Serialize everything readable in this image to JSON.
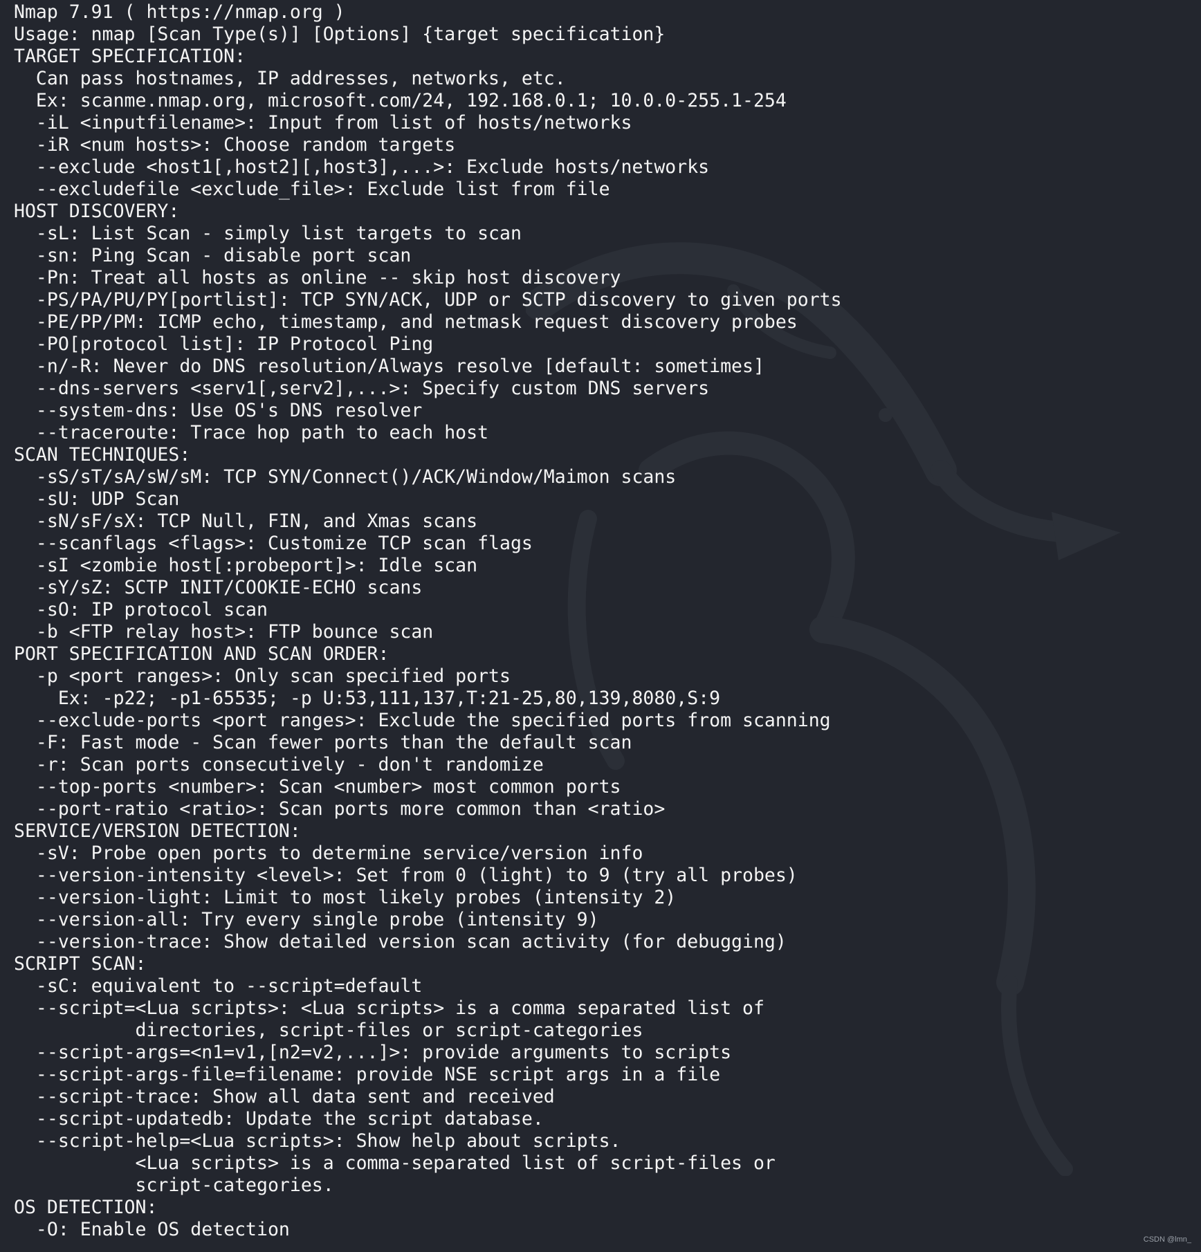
{
  "terminal": {
    "lines": [
      "Nmap 7.91 ( https://nmap.org )",
      "Usage: nmap [Scan Type(s)] [Options] {target specification}",
      "TARGET SPECIFICATION:",
      "  Can pass hostnames, IP addresses, networks, etc.",
      "  Ex: scanme.nmap.org, microsoft.com/24, 192.168.0.1; 10.0.0-255.1-254",
      "  -iL <inputfilename>: Input from list of hosts/networks",
      "  -iR <num hosts>: Choose random targets",
      "  --exclude <host1[,host2][,host3],...>: Exclude hosts/networks",
      "  --excludefile <exclude_file>: Exclude list from file",
      "HOST DISCOVERY:",
      "  -sL: List Scan - simply list targets to scan",
      "  -sn: Ping Scan - disable port scan",
      "  -Pn: Treat all hosts as online -- skip host discovery",
      "  -PS/PA/PU/PY[portlist]: TCP SYN/ACK, UDP or SCTP discovery to given ports",
      "  -PE/PP/PM: ICMP echo, timestamp, and netmask request discovery probes",
      "  -PO[protocol list]: IP Protocol Ping",
      "  -n/-R: Never do DNS resolution/Always resolve [default: sometimes]",
      "  --dns-servers <serv1[,serv2],...>: Specify custom DNS servers",
      "  --system-dns: Use OS's DNS resolver",
      "  --traceroute: Trace hop path to each host",
      "SCAN TECHNIQUES:",
      "  -sS/sT/sA/sW/sM: TCP SYN/Connect()/ACK/Window/Maimon scans",
      "  -sU: UDP Scan",
      "  -sN/sF/sX: TCP Null, FIN, and Xmas scans",
      "  --scanflags <flags>: Customize TCP scan flags",
      "  -sI <zombie host[:probeport]>: Idle scan",
      "  -sY/sZ: SCTP INIT/COOKIE-ECHO scans",
      "  -sO: IP protocol scan",
      "  -b <FTP relay host>: FTP bounce scan",
      "PORT SPECIFICATION AND SCAN ORDER:",
      "  -p <port ranges>: Only scan specified ports",
      "    Ex: -p22; -p1-65535; -p U:53,111,137,T:21-25,80,139,8080,S:9",
      "  --exclude-ports <port ranges>: Exclude the specified ports from scanning",
      "  -F: Fast mode - Scan fewer ports than the default scan",
      "  -r: Scan ports consecutively - don't randomize",
      "  --top-ports <number>: Scan <number> most common ports",
      "  --port-ratio <ratio>: Scan ports more common than <ratio>",
      "SERVICE/VERSION DETECTION:",
      "  -sV: Probe open ports to determine service/version info",
      "  --version-intensity <level>: Set from 0 (light) to 9 (try all probes)",
      "  --version-light: Limit to most likely probes (intensity 2)",
      "  --version-all: Try every single probe (intensity 9)",
      "  --version-trace: Show detailed version scan activity (for debugging)",
      "SCRIPT SCAN:",
      "  -sC: equivalent to --script=default",
      "  --script=<Lua scripts>: <Lua scripts> is a comma separated list of",
      "           directories, script-files or script-categories",
      "  --script-args=<n1=v1,[n2=v2,...]>: provide arguments to scripts",
      "  --script-args-file=filename: provide NSE script args in a file",
      "  --script-trace: Show all data sent and received",
      "  --script-updatedb: Update the script database.",
      "  --script-help=<Lua scripts>: Show help about scripts.",
      "           <Lua scripts> is a comma-separated list of script-files or",
      "           script-categories.",
      "OS DETECTION:",
      "  -O: Enable OS detection"
    ]
  },
  "footer": {
    "credit": "CSDN @lmn_"
  },
  "colors": {
    "background": "#23262e",
    "text": "#f4f4f4",
    "watermark": "#2c3038"
  },
  "icons": {
    "watermark": "kali-dragon-logo"
  }
}
